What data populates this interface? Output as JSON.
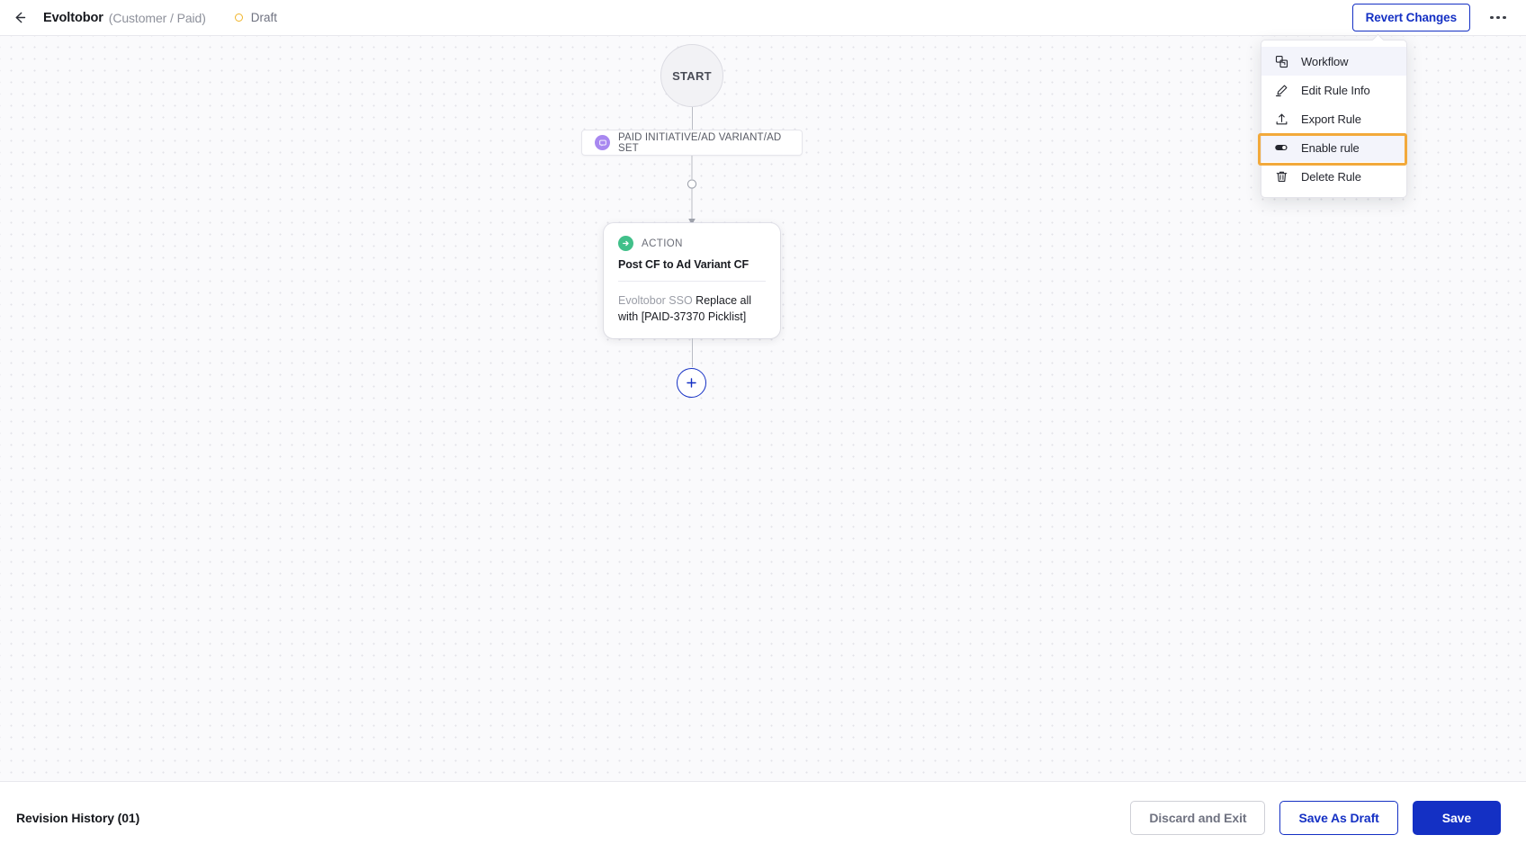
{
  "header": {
    "back_icon": "arrow-left-icon",
    "rule_name": "Evoltobor",
    "rule_scope": "(Customer / Paid)",
    "status_label": "Draft",
    "status_color": "#f0b429",
    "revert_label": "Revert Changes",
    "kebab_icon": "more-horizontal-icon"
  },
  "menu": {
    "items": [
      {
        "label": "Workflow",
        "icon": "workflow-icon",
        "hovered": true,
        "highlighted": false
      },
      {
        "label": "Edit Rule Info",
        "icon": "pencil-icon",
        "hovered": false,
        "highlighted": false
      },
      {
        "label": "Export Rule",
        "icon": "upload-icon",
        "hovered": false,
        "highlighted": false
      },
      {
        "label": "Enable rule",
        "icon": "toggle-icon",
        "hovered": true,
        "highlighted": true
      },
      {
        "label": "Delete Rule",
        "icon": "trash-icon",
        "hovered": false,
        "highlighted": false
      }
    ],
    "highlight_color": "#f2a93b"
  },
  "canvas": {
    "start_label": "START",
    "trigger": {
      "label": "PAID INITIATIVE/AD VARIANT/AD SET",
      "icon": "trigger-bubble-icon",
      "icon_color": "#a888f0"
    },
    "action": {
      "kind": "ACTION",
      "icon": "arrow-circle-right-icon",
      "icon_color": "#41c08a",
      "title": "Post CF to Ad Variant CF",
      "body_muted": "Evoltobor SSO",
      "body_main": "Replace all with [PAID-37370 Picklist]"
    },
    "add_button_icon": "plus-icon",
    "accent_color": "#1430c4"
  },
  "footer": {
    "revision_history": "Revision History (01)",
    "discard_label": "Discard and Exit",
    "draft_label": "Save As Draft",
    "save_label": "Save"
  }
}
